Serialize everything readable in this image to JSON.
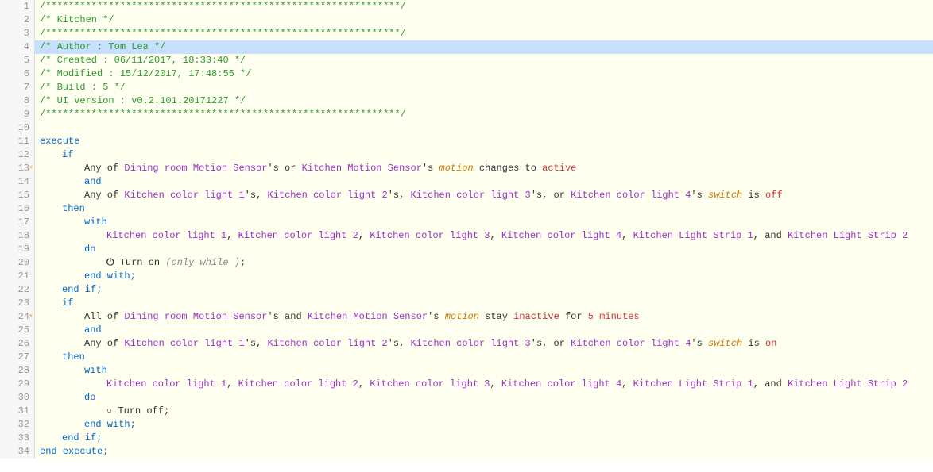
{
  "header": {
    "c1": "/**************************************************************/",
    "c2": "/*  Kitchen                                                   */",
    "c3": "/**************************************************************/",
    "c4": "/*  Author     : Tom Lea                                      */",
    "c5": "/*  Created    : 06/11/2017, 18:33:40                         */",
    "c6": "/*  Modified   : 15/12/2017, 17:48:55                         */",
    "c7": "/*  Build      : 5                                            */",
    "c8": "/*  UI version : v0.2.101.20171227                            */",
    "c9": "/**************************************************************/"
  },
  "kw": {
    "execute": "execute",
    "if": "if",
    "then": "then",
    "with": "with",
    "do": "do",
    "endwith": "end with;",
    "endif": "end if;",
    "endexecute": "end execute;",
    "and": "and"
  },
  "devices": {
    "dining_motion": "Dining room Motion Sensor",
    "kitchen_motion": "Kitchen Motion Sensor",
    "kcl1": "Kitchen color light 1",
    "kcl2": "Kitchen color light 2",
    "kcl3": "Kitchen color light 3",
    "kcl4": "Kitchen color light 4",
    "kls1": "Kitchen Light Strip 1",
    "kls2": "Kitchen Light Strip 2"
  },
  "text": {
    "any_of": "Any of ",
    "all_of": "All of ",
    "s_or": "'s or ",
    "s_and": "'s and ",
    "s": "'s ",
    "s_comma": "'s, ",
    "s_or2": "'s, or ",
    "motion": "motion",
    "changes_to": " changes to ",
    "switch": "switch",
    "is": " is ",
    "stay": " stay ",
    "for": " for ",
    "comma": ", ",
    "and": ", and ",
    "turn_on": " Turn on ",
    "only_while": "(only while )",
    "turn_off": " Turn off;",
    "semi": ";"
  },
  "states": {
    "active": "active",
    "inactive": "inactive",
    "off": "off",
    "on": "on",
    "five_min": "5 minutes"
  },
  "icons": {
    "power": "⏻",
    "circle": "○"
  }
}
